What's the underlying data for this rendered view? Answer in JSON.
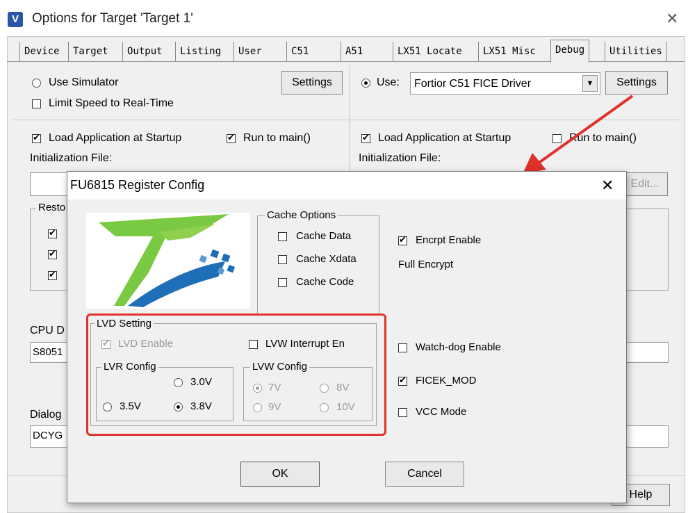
{
  "outer": {
    "title": "Options for Target 'Target 1'",
    "app_icon_letter": "V",
    "close_glyph": "✕",
    "tabs": [
      "Device",
      "Target",
      "Output",
      "Listing",
      "User",
      "C51",
      "A51",
      "LX51 Locate",
      "LX51 Misc",
      "Debug",
      "Utilities"
    ],
    "active_tab": "Debug",
    "left": {
      "use_simulator": "Use Simulator",
      "limit_speed": "Limit Speed to Real-Time",
      "settings": "Settings",
      "load_app": "Load Application at Startup",
      "run_to_main": "Run to main()",
      "init_file": "Initialization File:",
      "restore_partial": "Resto",
      "cpu_dll_partial": "CPU D",
      "cpu_dll_value": "S8051",
      "dialog_dll_partial": "Dialog",
      "dialog_dll_value": "DCYG"
    },
    "right": {
      "use": "Use:",
      "driver": "Fortior C51 FICE Driver",
      "settings": "Settings",
      "load_app": "Load Application at Startup",
      "run_to_main": "Run to main()",
      "init_file": "Initialization File:",
      "edit": "Edit...",
      "help": "Help"
    }
  },
  "dialog": {
    "title": "FU6815 Register Config",
    "close_glyph": "✕",
    "cache_options": {
      "title": "Cache Options",
      "cache_data": "Cache Data",
      "cache_xdata": "Cache Xdata",
      "cache_code": "Cache Code"
    },
    "encrypt_enable": "Encrpt Enable",
    "full_encrypt": "Full Encrypt",
    "lvd_setting": {
      "title": "LVD Setting",
      "lvd_enable": "LVD Enable",
      "lvw_interrupt": "LVW Interrupt En",
      "lvr_config": {
        "title": "LVR Config",
        "opt_30": "3.0V",
        "opt_35": "3.5V",
        "opt_38": "3.8V",
        "selected": "3.8V"
      },
      "lvw_config": {
        "title": "LVW Config",
        "opt_7": "7V",
        "opt_8": "8V",
        "opt_9": "9V",
        "opt_10": "10V",
        "selected": "7V"
      }
    },
    "watchdog": "Watch-dog Enable",
    "ficek_mod": "FICEK_MOD",
    "vcc_mode": "VCC Mode",
    "ok": "OK",
    "cancel": "Cancel"
  },
  "colors": {
    "highlight_box": "#e0312b",
    "arrow": "#e0312b",
    "logo_green": "#7ac943",
    "logo_blue": "#1f6fb8"
  }
}
